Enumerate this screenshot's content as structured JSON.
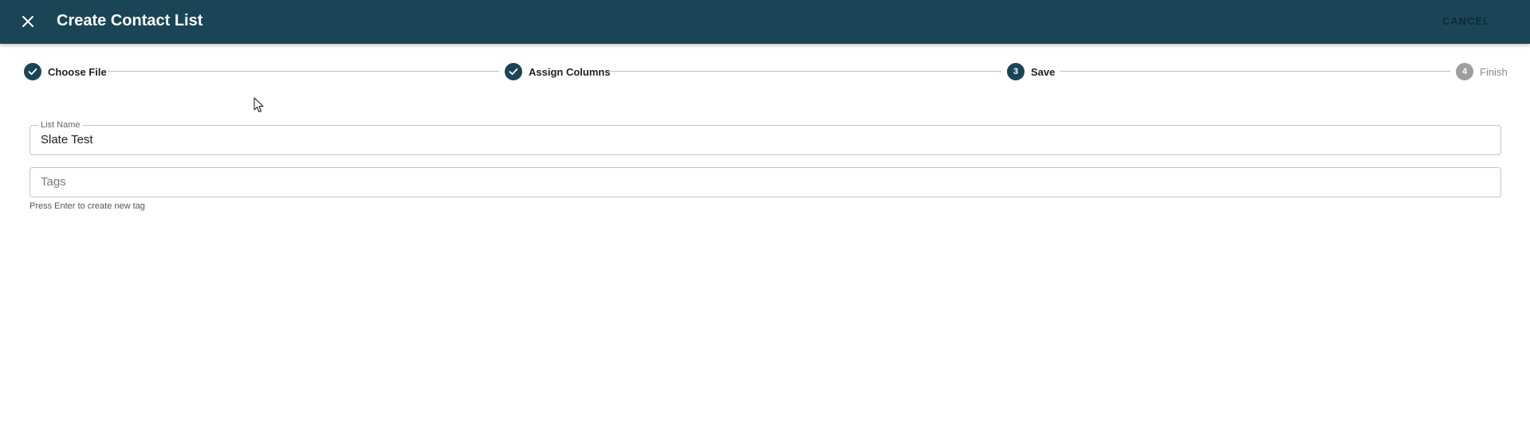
{
  "appbar": {
    "title": "Create Contact List",
    "close_icon": "close-icon",
    "cancel_label": "CANCEL",
    "background": "#1a4556"
  },
  "stepper": {
    "steps": [
      {
        "label": "Choose File",
        "state": "completed",
        "indicator": "check-icon"
      },
      {
        "label": "Assign Columns",
        "state": "completed",
        "indicator": "check-icon"
      },
      {
        "label": "Save",
        "state": "active",
        "number": "3"
      },
      {
        "label": "Finish",
        "state": "inactive",
        "number": "4"
      }
    ],
    "active_color": "#1a4556",
    "inactive_color": "#9e9e9e"
  },
  "form": {
    "list_name": {
      "label": "List Name",
      "value": "Slate Test"
    },
    "tags": {
      "placeholder": "Tags",
      "value": "",
      "helper_text": "Press Enter to create new tag"
    }
  }
}
